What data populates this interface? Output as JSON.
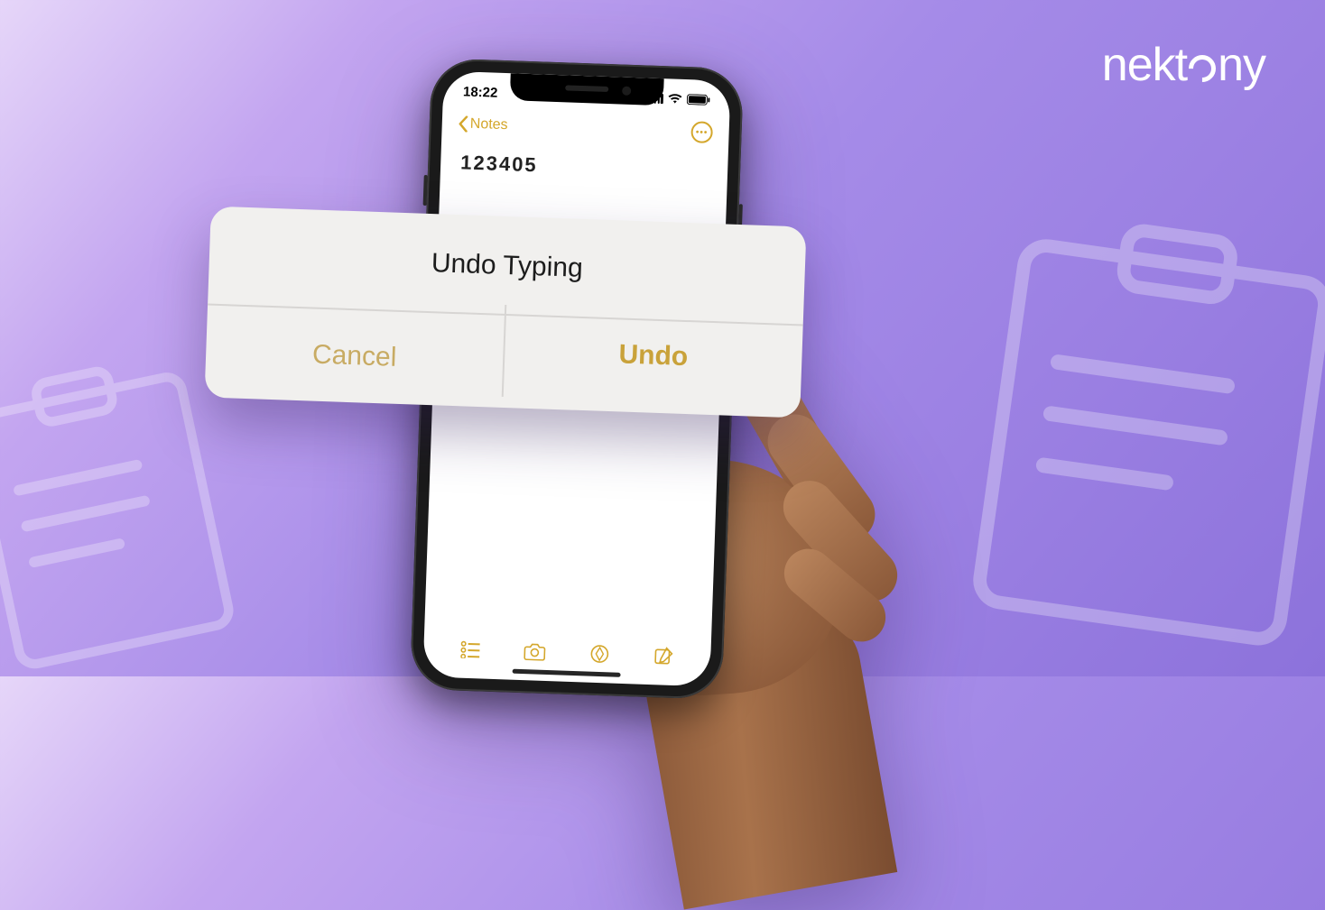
{
  "brand": {
    "name": "nektony"
  },
  "phone": {
    "status": {
      "time": "18:22"
    },
    "nav": {
      "back_label": "Notes"
    },
    "note": {
      "content": "123405"
    },
    "toolbar_icons": {
      "checklist": "checklist-icon",
      "camera": "camera-icon",
      "sketch": "sketch-icon",
      "compose": "compose-icon"
    }
  },
  "alert": {
    "title": "Undo Typing",
    "cancel_label": "Cancel",
    "undo_label": "Undo"
  },
  "colors": {
    "accent": "#d4a72c",
    "alert_bg": "#f1f0ee",
    "gradient_start": "#e6d6f9",
    "gradient_end": "#8c72db"
  }
}
